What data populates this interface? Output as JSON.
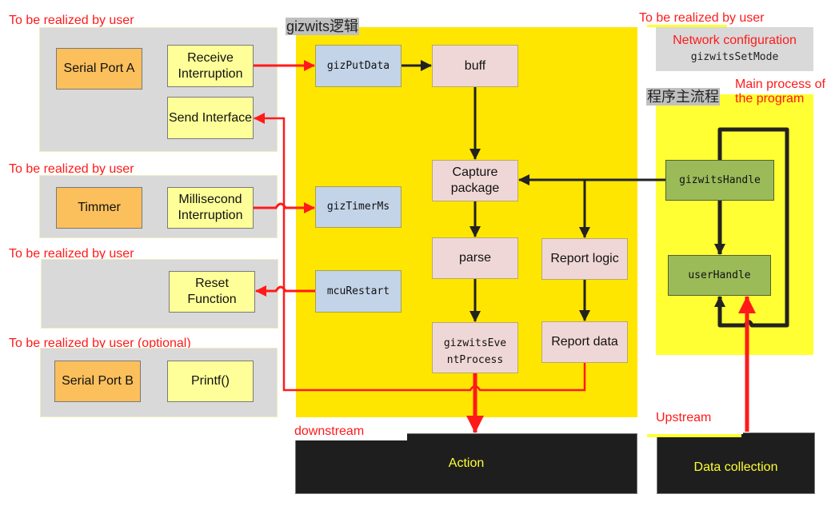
{
  "left_column": {
    "group_a": {
      "label": "To be realized by user",
      "serial_port": "Serial Port A",
      "receive": "Receive Interruption",
      "send": "Send Interface"
    },
    "group_b": {
      "label": "To be realized by user",
      "timer": "Timmer",
      "ms_interrupt": "Millisecond Interruption"
    },
    "group_c": {
      "label": "To be realized by user",
      "reset": "Reset Function"
    },
    "group_d": {
      "label": "To be realized by user (optional)",
      "serial_port": "Serial Port B",
      "printf": "Printf()"
    }
  },
  "gizwits_logic": {
    "title": "gizwits逻辑",
    "giz_put_data": "gizPutData",
    "buff": "buff",
    "giz_timer_ms": "gizTimerMs",
    "mcu_restart": "mcuRestart",
    "capture_package": "Capture package",
    "parse": "parse",
    "report_logic": "Report logic",
    "event_process": "gizwitsEventProcess",
    "report_data": "Report data"
  },
  "right_column": {
    "network_label": "To be realized by user",
    "network_title": "Network configuration",
    "network_func": "gizwitsSetMode",
    "main_title": "程序主流程",
    "main_label": "Main process of the program",
    "gizwits_handle": "gizwitsHandle",
    "user_handle": "userHandle"
  },
  "bottom": {
    "downstream": "downstream",
    "upstream": "Upstream",
    "action": "Action",
    "data_collection": "Data collection"
  },
  "colors": {
    "annotation_red": "#ff1a1a",
    "logic_yellow": "#ffe600",
    "main_yellow": "#ffff33",
    "device_orange": "#fbbf5c",
    "interface_yellow": "#ffff99",
    "gizwits_blue": "#c3d3e8",
    "process_pink": "#f0d7d7",
    "handle_green": "#9bbb59",
    "hardware_black": "#1e1e1e"
  }
}
